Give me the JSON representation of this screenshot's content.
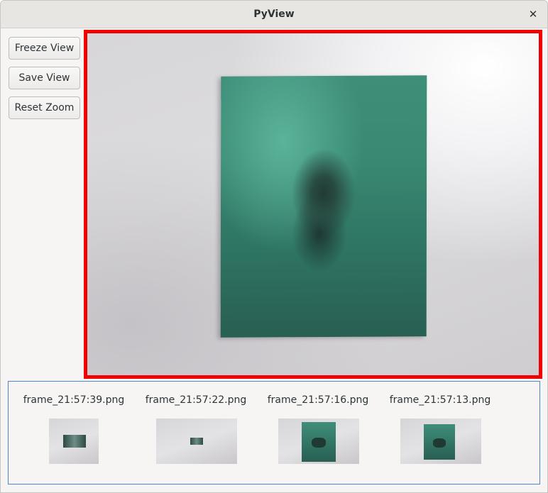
{
  "window": {
    "title": "PyView",
    "close_symbol": "✕"
  },
  "sidebar": {
    "buttons": [
      {
        "label": "Freeze View"
      },
      {
        "label": "Save View"
      },
      {
        "label": "Reset Zoom"
      }
    ]
  },
  "view": {
    "border_color": "#f00000"
  },
  "thumbnails": [
    {
      "filename": "frame_21:57:39.png"
    },
    {
      "filename": "frame_21:57:22.png"
    },
    {
      "filename": "frame_21:57:16.png"
    },
    {
      "filename": "frame_21:57:13.png"
    }
  ],
  "colors": {
    "accent_border": "#4a86c8",
    "book_green": "#3a8a73"
  }
}
